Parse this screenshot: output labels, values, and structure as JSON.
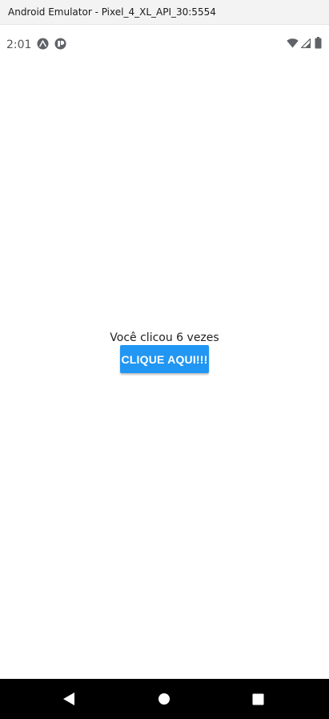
{
  "window": {
    "title": "Android Emulator - Pixel_4_XL_API_30:5554"
  },
  "status_bar": {
    "time": "2:01",
    "notification_icons": [
      "expo-icon",
      "app-notification-icon"
    ],
    "system_icons": [
      "wifi-icon",
      "cell-signal-icon",
      "battery-icon"
    ]
  },
  "main": {
    "counter_text": "Você clicou 6 vezes",
    "button_label": "CLIQUE AQUI!!!"
  },
  "nav_bar": {
    "buttons": [
      "back-icon",
      "home-icon",
      "recents-icon"
    ]
  },
  "colors": {
    "button": "#2196f3",
    "nav_bar": "#000000",
    "title_bar": "#f3f3f3"
  }
}
